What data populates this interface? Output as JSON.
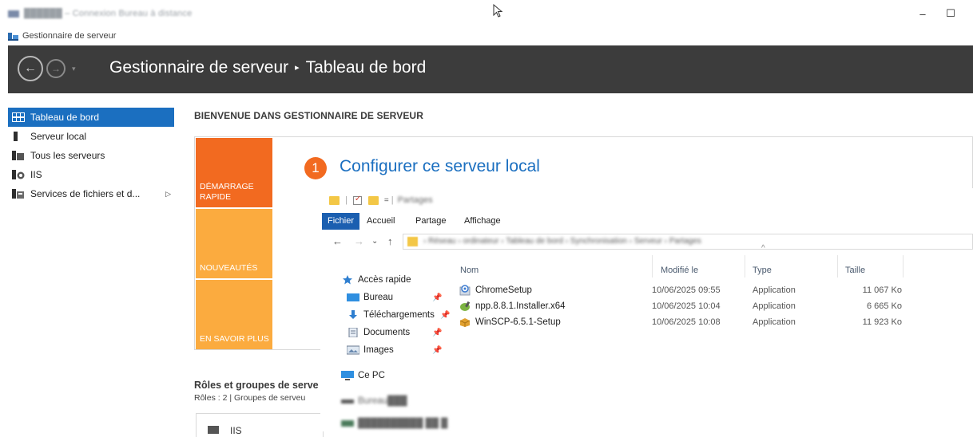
{
  "rdp": {
    "title": "██████ – Connexion Bureau à distance",
    "minimize_glyph": "–",
    "maximize_glyph": "☐"
  },
  "server_manager": {
    "app_title": "Gestionnaire de serveur",
    "breadcrumb_root": "Gestionnaire de serveur",
    "breadcrumb_sep": "▸",
    "breadcrumb_page": "Tableau de bord",
    "nav_back_glyph": "←",
    "nav_fwd_glyph": "→",
    "nav_drop_glyph": "▾"
  },
  "sidebar": {
    "items": [
      {
        "label": "Tableau de bord",
        "icon": "dashboard-icon",
        "active": true
      },
      {
        "label": "Serveur local",
        "icon": "server-icon"
      },
      {
        "label": "Tous les serveurs",
        "icon": "servers-icon"
      },
      {
        "label": "IIS",
        "icon": "iis-icon"
      },
      {
        "label": "Services de fichiers et d...",
        "icon": "file-services-icon",
        "arrow": "▷"
      }
    ]
  },
  "welcome": {
    "title": "BIENVENUE DANS GESTIONNAIRE DE SERVEUR",
    "tiles": [
      "DÉMARRAGE RAPIDE",
      "NOUVEAUTÉS",
      "EN SAVOIR PLUS"
    ],
    "step_number": "1",
    "step_title": "Configurer ce serveur local"
  },
  "roles": {
    "title": "Rôles et groupes de serve",
    "subtitle": "Rôles : 2   |   Groupes de serveu",
    "card_label": "IIS"
  },
  "explorer": {
    "qa_title": "Partages",
    "ribbon_tabs": [
      "Fichier",
      "Accueil",
      "Partage",
      "Affichage"
    ],
    "nav_back": "←",
    "nav_forward": "→",
    "nav_recent": "⌄",
    "nav_up": "↑",
    "address_path": "› Réseau › ordinateur › Tableau de bord › Synchronisation › Serveur › Partages",
    "quick_access": "Accès rapide",
    "pin_glyph": "📌",
    "nav_items": [
      {
        "label": "Bureau",
        "icon": "desktop-icon",
        "pinned": true
      },
      {
        "label": "Téléchargements",
        "icon": "downloads-icon",
        "pinned": true
      },
      {
        "label": "Documents",
        "icon": "documents-icon",
        "pinned": true
      },
      {
        "label": "Images",
        "icon": "pictures-icon",
        "pinned": true
      }
    ],
    "this_pc": "Ce PC",
    "blurred_nav_1": "Bureau███",
    "blurred_nav_2": "██████████ ██ █",
    "columns": {
      "name": "Nom",
      "modified": "Modifié le",
      "type": "Type",
      "size": "Taille",
      "sort_glyph": "^"
    },
    "files": [
      {
        "name": "ChromeSetup",
        "modified": "10/06/2025 09:55",
        "type": "Application",
        "size": "11 067 Ko",
        "icon": "chrome-installer-icon"
      },
      {
        "name": "npp.8.8.1.Installer.x64",
        "modified": "10/06/2025 10:04",
        "type": "Application",
        "size": "6 665 Ko",
        "icon": "notepadpp-icon"
      },
      {
        "name": "WinSCP-6.5.1-Setup",
        "modified": "10/06/2025 10:08",
        "type": "Application",
        "size": "11 923 Ko",
        "icon": "winscp-icon"
      }
    ]
  },
  "colors": {
    "header_dark": "#3c3c3c",
    "accent_blue": "#1b6fc0",
    "tile_orange": "#f26a20",
    "tile_amber": "#fbab3f"
  }
}
